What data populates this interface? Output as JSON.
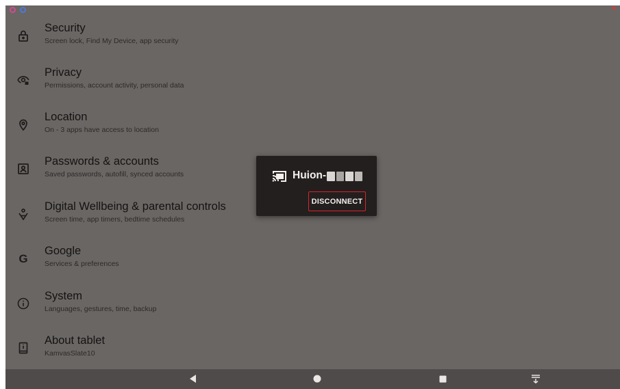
{
  "settings": {
    "items": [
      {
        "icon": "lock-icon",
        "title": "Security",
        "subtitle": "Screen lock, Find My Device, app security"
      },
      {
        "icon": "privacy-eye-icon",
        "title": "Privacy",
        "subtitle": "Permissions, account activity, personal data"
      },
      {
        "icon": "location-pin-icon",
        "title": "Location",
        "subtitle": "On - 3 apps have access to location"
      },
      {
        "icon": "account-box-icon",
        "title": "Passwords & accounts",
        "subtitle": "Saved passwords, autofill, synced accounts"
      },
      {
        "icon": "wellbeing-icon",
        "title": "Digital Wellbeing & parental controls",
        "subtitle": "Screen time, app timers, bedtime schedules"
      },
      {
        "icon": "google-g-icon",
        "title": "Google",
        "subtitle": "Services & preferences"
      },
      {
        "icon": "info-icon",
        "title": "System",
        "subtitle": "Languages, gestures, time, backup"
      },
      {
        "icon": "tablet-icon",
        "title": "About tablet",
        "subtitle": "KamvasSlate10"
      }
    ]
  },
  "cast_dialog": {
    "icon": "cast-connected-icon",
    "device_name": "Huion-",
    "disconnect_label": "DISCONNECT",
    "highlight_color": "#d9232d"
  },
  "navbar": {
    "back": "back-triangle-icon",
    "home": "home-circle-icon",
    "recents": "recents-square-icon",
    "extra": "nav-extra-icon"
  },
  "colors": {
    "background_scrim": "#6a6664",
    "dialog": "#231f1e",
    "navbar": "#4f4b4a"
  }
}
